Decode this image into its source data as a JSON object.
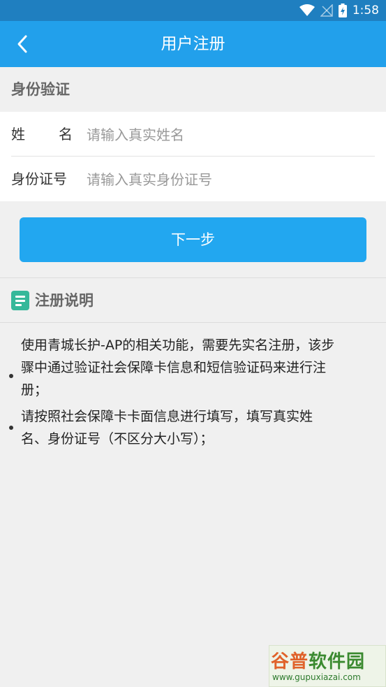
{
  "status_bar": {
    "time": "1:58",
    "icons": [
      "wifi-icon",
      "signal-icon",
      "battery-icon"
    ]
  },
  "header": {
    "title": "用户注册",
    "back_icon": "chevron-left-icon"
  },
  "identity_section": {
    "title": "身份验证",
    "fields": [
      {
        "label_chars": [
          "姓",
          "名"
        ],
        "placeholder": "请输入真实姓名",
        "value": ""
      },
      {
        "label": "身份证号",
        "placeholder": "请输入真实身份证号",
        "value": ""
      }
    ]
  },
  "next_button": {
    "label": "下一步"
  },
  "notes_section": {
    "title": "注册说明",
    "icon": "document-icon",
    "items": [
      [
        "使用青城长护-AP的相关功能，需要先实名注册，该步",
        "骤中通过验证社会保障卡信息和短信验证码来进行注",
        "册；"
      ],
      [
        "请按照社会保障卡卡面信息进行填写，填写真实姓",
        "名、身份证号（不区分大小写）；"
      ]
    ]
  },
  "watermark": {
    "brand_a": "谷普",
    "brand_b": "软件园",
    "url": "www.gupuxiazai.com"
  },
  "colors": {
    "status_bar": "#1f7fc0",
    "app_bar": "#22a0eb",
    "button": "#22a7f0",
    "note_icon": "#35b89a",
    "background": "#f0f0f0"
  }
}
